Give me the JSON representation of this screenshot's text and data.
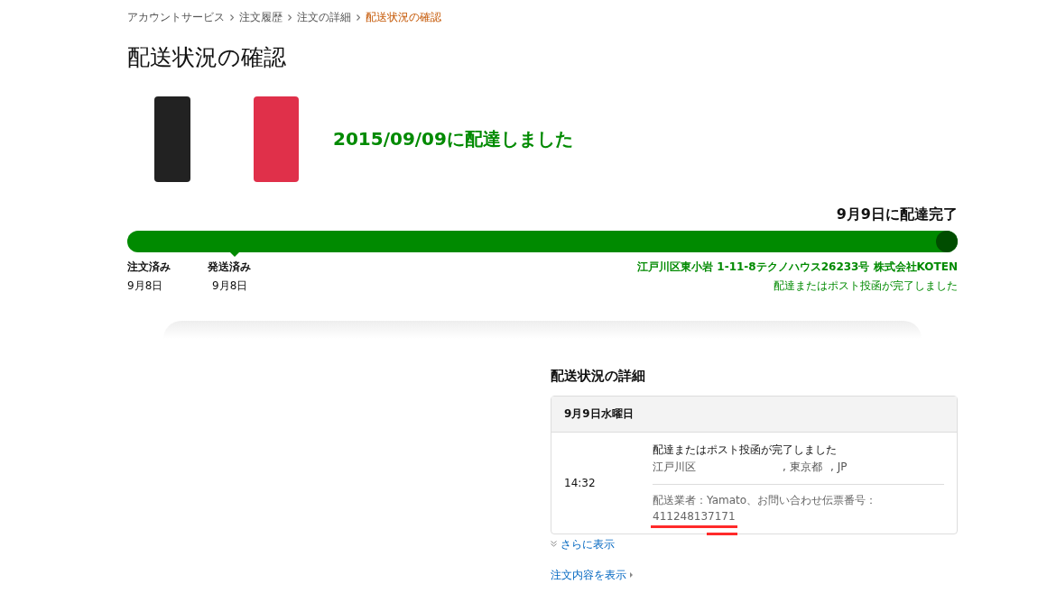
{
  "breadcrumb": [
    {
      "label": "アカウントサービス",
      "selected": false
    },
    {
      "label": "注文履歴",
      "selected": false
    },
    {
      "label": "注文の詳細",
      "selected": false
    },
    {
      "label": "配送状況の確認",
      "selected": true
    }
  ],
  "title": "配送状況の確認",
  "delivery_headline": "2015/09/09に配達しました",
  "progress": {
    "status": "9月9日に配達完了",
    "level": 1,
    "steps": [
      {
        "label": "注文済み",
        "date": "9月8日",
        "marked": false
      },
      {
        "label": "発送済み",
        "date": "9月8日",
        "marked": true
      }
    ],
    "address": "江戸川区東小岩 1-11-8テクノハウス26233号 株式会社KOTEN",
    "message": "配達またはポスト投函が完了しました"
  },
  "details": {
    "heading": "配送状況の詳細",
    "date": "9月9日水曜日",
    "time": "14:32",
    "event": "配達またはポスト投函が完了しました",
    "location": [
      "江戸川区",
      ", 東京都",
      ", JP"
    ],
    "carrier": "配送業者：Yamato、お問い合わせ伝票番号：",
    "tracking_number": "411248137171"
  },
  "more_link": "さらに表示",
  "order_link": "注文内容を表示"
}
